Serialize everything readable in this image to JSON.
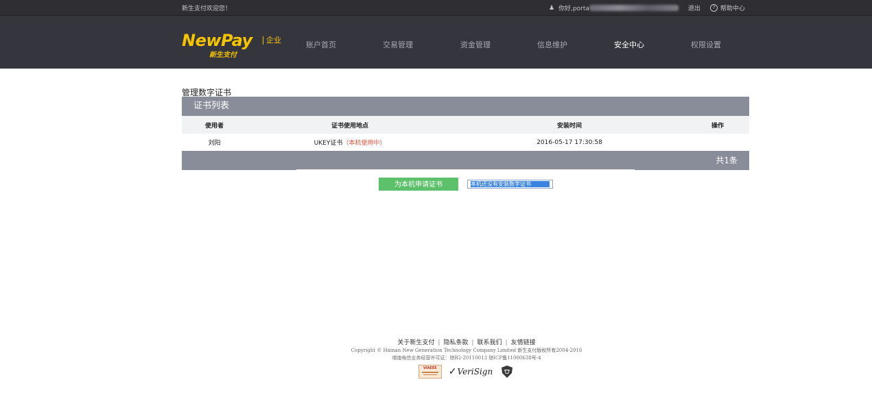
{
  "header": {
    "welcome": "新生支付欢迎您！",
    "greeting": "你好,porta",
    "logout": "退出",
    "help": "帮助中心"
  },
  "logo": {
    "word": "NewPay",
    "chinese": "新生支付",
    "edition": "企业",
    "color": "#f5c400"
  },
  "nav": {
    "items": [
      {
        "label": "账户首页",
        "active": false
      },
      {
        "label": "交易管理",
        "active": false
      },
      {
        "label": "资金管理",
        "active": false
      },
      {
        "label": "信息维护",
        "active": false
      },
      {
        "label": "安全中心",
        "active": true
      },
      {
        "label": "权限设置",
        "active": false
      }
    ]
  },
  "main": {
    "page_title": "管理数字证书",
    "panel_title": "证书列表",
    "columns": [
      "使用者",
      "证书使用地点",
      "安装时间",
      "操作"
    ],
    "rows": [
      {
        "user": "刘阳",
        "location": "UKEY证书",
        "status": "（本机使用中）",
        "installed": "2016-05-17 17:30:58",
        "action": ""
      }
    ],
    "total": "共1条",
    "apply_button": "为本机申请证书",
    "no_cert_notice": "本机还没有安装数字证书"
  },
  "footer": {
    "links": [
      "关于新生支付",
      "隐私条款",
      "联系我们",
      "友情链接"
    ],
    "copyright": "Copyright © Hainan New Generation Technology Company Limited 新生支付版权所有2004-2016",
    "license": "增值电信业务经营许可证：琼B2-20110013 琼ICP备11000638号-4",
    "badges": {
      "verisign": "VeriSign",
      "seal_text": "VIAEEE"
    }
  },
  "colors": {
    "header_bg": "#35353d",
    "panel_bar": "#888d99",
    "button_green": "#5cc16a",
    "in_use_red": "#e0513b"
  }
}
